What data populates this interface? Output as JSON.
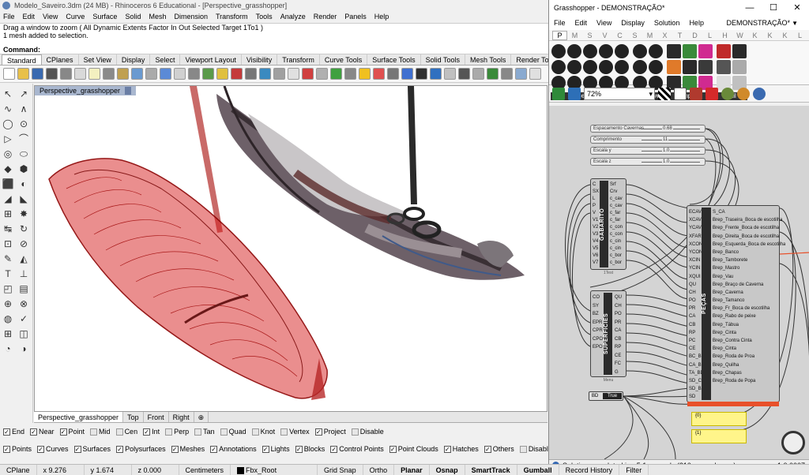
{
  "rhino": {
    "title": "Modelo_Saveiro.3dm (24 MB) - Rhinoceros 6 Educational - [Perspective_grasshopper]",
    "menu": [
      "File",
      "Edit",
      "View",
      "Curve",
      "Surface",
      "Solid",
      "Mesh",
      "Dimension",
      "Transform",
      "Tools",
      "Analyze",
      "Render",
      "Panels",
      "Help"
    ],
    "command_history": [
      "Drag a window to zoom ( All Dynamic Extents Factor In Out Selected Target 1To1 )",
      "1 mesh added to selection."
    ],
    "command_prompt": "Command:",
    "tabs": [
      "Standard",
      "CPlanes",
      "Set View",
      "Display",
      "Select",
      "Viewport Layout",
      "Visibility",
      "Transform",
      "Curve Tools",
      "Surface Tools",
      "Solid Tools",
      "Mesh Tools",
      "Render Tools",
      "Drafting"
    ],
    "viewport_title": "Perspective_grasshopper",
    "viewport_tabs": [
      "Perspective_grasshopper",
      "Top",
      "Front",
      "Right"
    ],
    "osnaps": [
      {
        "label": "End",
        "checked": true
      },
      {
        "label": "Near",
        "checked": true
      },
      {
        "label": "Point",
        "checked": true
      },
      {
        "label": "Mid",
        "checked": false
      },
      {
        "label": "Cen",
        "checked": false
      },
      {
        "label": "Int",
        "checked": true
      },
      {
        "label": "Perp",
        "checked": false
      },
      {
        "label": "Tan",
        "checked": false
      },
      {
        "label": "Quad",
        "checked": false
      },
      {
        "label": "Knot",
        "checked": false
      },
      {
        "label": "Vertex",
        "checked": false
      },
      {
        "label": "Project",
        "checked": true
      },
      {
        "label": "Disable",
        "checked": false
      }
    ],
    "filters": [
      {
        "label": "Points",
        "checked": true
      },
      {
        "label": "Curves",
        "checked": true
      },
      {
        "label": "Surfaces",
        "checked": true
      },
      {
        "label": "Polysurfaces",
        "checked": true
      },
      {
        "label": "Meshes",
        "checked": true
      },
      {
        "label": "Annotations",
        "checked": true
      },
      {
        "label": "Lights",
        "checked": true
      },
      {
        "label": "Blocks",
        "checked": true
      },
      {
        "label": "Control Points",
        "checked": true
      },
      {
        "label": "Point Clouds",
        "checked": true
      },
      {
        "label": "Hatches",
        "checked": true
      },
      {
        "label": "Others",
        "checked": true
      },
      {
        "label": "Disable",
        "checked": false
      }
    ],
    "status": {
      "cplane": "CPlane",
      "x": "x 9.276",
      "y": "y 1.674",
      "z": "z 0.000",
      "units": "Centimeters",
      "layer": "Fbx_Root",
      "items": [
        "Grid Snap",
        "Ortho",
        "Planar",
        "Osnap",
        "SmartTrack",
        "Gumball",
        "Record History",
        "Filter"
      ],
      "bold_items": [
        "Planar",
        "Osnap",
        "SmartTrack",
        "Gumball"
      ]
    },
    "colors": {
      "hull_red": "#d41a1a",
      "viewport_title_bg": "#a9b7cf"
    }
  },
  "grasshopper": {
    "title": "Grasshopper - DEMONSTRAÇÃO*",
    "menu": [
      "File",
      "Edit",
      "View",
      "Display",
      "Solution",
      "Help"
    ],
    "document": "DEMONSTRAÇÃO*",
    "tabs": [
      "P",
      "M",
      "S",
      "V",
      "C",
      "S",
      "M",
      "X",
      "T",
      "D",
      "L",
      "H",
      "W",
      "K",
      "K",
      "K",
      "L"
    ],
    "palette_groups": [
      "Geometry",
      "Primitive",
      "Input",
      "Util"
    ],
    "zoom": "72%",
    "sliders": [
      {
        "label": "Espacamento Cavernas",
        "value": "0.68"
      },
      {
        "label": "Comprimento",
        "value": "11"
      },
      {
        "label": "Escala y",
        "value": "1.0"
      },
      {
        "label": "Escala z",
        "value": "1.0"
      }
    ],
    "gabarito": {
      "name": "GABARITO",
      "inputs": [
        "C",
        "SX",
        "L",
        "P",
        "V",
        "V1",
        "V2",
        "V3",
        "V4",
        "V5",
        "V6",
        "V7"
      ],
      "outputs": [
        "Srf",
        "Crv",
        "c_cav",
        "c_cav",
        "c_far",
        "c_far",
        "c_con",
        "c_con",
        "c_cin",
        "c_cin",
        "c_bor",
        "c_bor"
      ],
      "footer": "1Test"
    },
    "superficies": {
      "name": "SUPERFICIES",
      "inputs": [
        "CO",
        "SY",
        "BZ",
        "EPR",
        "CPR",
        "CPO",
        "EPO"
      ],
      "outputs": [
        "QU",
        "CH",
        "PO",
        "PR",
        "CA",
        "CB",
        "RP",
        "CE",
        "FC",
        "G"
      ],
      "footer": "Menu"
    },
    "pecas": {
      "name": "PEÇAS",
      "inputs": [
        "ECAV",
        "XCAV",
        "YCAV",
        "XFAR",
        "XCON",
        "YCON",
        "XCIN",
        "YCIN",
        "XQUI",
        "QU",
        "CH",
        "PO",
        "PR",
        "CA",
        "CB",
        "RP",
        "PC",
        "CE",
        "BC_BD",
        "CA_BD",
        "TA_BD",
        "SD_CA",
        "SD_BZ",
        "SD"
      ],
      "outputs": [
        "S_CA",
        "Brep_Traseira_Boca de escotilha",
        "Brep_Frente_Boca de escotilha",
        "Brep_Direita_Boca de escotilha",
        "Brep_Esquerda_Boca de escotilha",
        "Brep_Banco",
        "Brep_Tamborete",
        "Brep_Mastro",
        "Brep_Vau",
        "Brep_Braço de Caverna",
        "Brep_Caverna",
        "Brep_Tamanco",
        "Brep_Fr_Boca de escotilha",
        "Brep_Rabo de peixe",
        "Brep_Tábua",
        "Brep_Cinta",
        "Brep_Contra Cinta",
        "Brep_Cinta",
        "Brep_Roda de Proa",
        "Brep_Quilha",
        "Brep_Chapas",
        "Brep_Roda de Popa"
      ]
    },
    "bool_node": {
      "label": "BD",
      "value": "True"
    },
    "panels": [
      "{0}",
      "{1}"
    ],
    "status": "Solution completed in ~5.1 seconds (210 seconds ago)",
    "version": "1.0.0007",
    "colors": {
      "canvas": "#d4d4d4",
      "panel_yellow": "#fff58a",
      "core": "#2b2b2b",
      "pecas_footer": "#e8502a"
    }
  }
}
